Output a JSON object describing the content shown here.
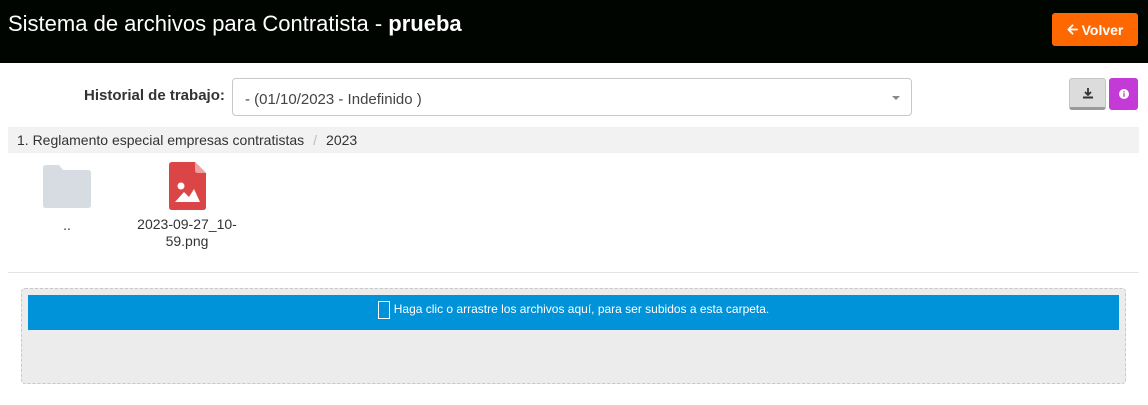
{
  "header": {
    "title_prefix": "Sistema de archivos para Contratista - ",
    "title_bold": "prueba",
    "back_label": "Volver"
  },
  "history": {
    "label": "Historial de trabajo:",
    "selected": "- (01/10/2023 - Indefinido )"
  },
  "breadcrumb": {
    "items": [
      "1. Reglamento especial empresas contratistas",
      "2023"
    ],
    "separator": "/"
  },
  "files": [
    {
      "name": "..",
      "icon": "folder-icon"
    },
    {
      "name": "2023-09-27_10-59.png",
      "icon": "image-file-icon"
    }
  ],
  "dropzone": {
    "message": "Haga clic o arrastre los archivos aquí, para ser subidos a esta carpeta."
  },
  "colors": {
    "topbar": "#000500",
    "back_button": "#ff6700",
    "info_button": "#c33ad6",
    "drop_bar": "#0093d9",
    "png_icon": "#dc4545"
  }
}
